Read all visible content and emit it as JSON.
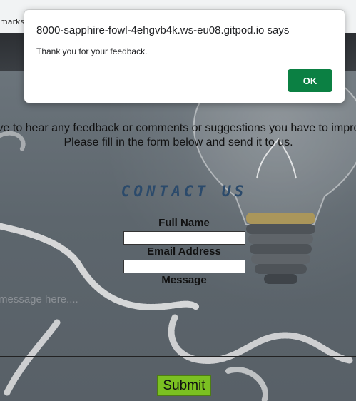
{
  "browser": {
    "bookmarks_fragment": "marks"
  },
  "page": {
    "intro_line1": "ove to hear any feedback or comments or suggestions you have to improv",
    "intro_line2": "Please fill in the form below and send it to us.",
    "contact_heading": "CONTACT US",
    "form": {
      "full_name_label": "Full Name",
      "full_name_value": "",
      "email_label": "Email Address",
      "email_value": "",
      "message_label": "Message",
      "message_placeholder": "message here....",
      "submit_label": "Submit"
    }
  },
  "dialog": {
    "title": "8000-sapphire-fowl-4ehgvb4k.ws-eu08.gitpod.io says",
    "message": "Thank you for your feedback.",
    "ok_label": "OK"
  },
  "colors": {
    "ok_button": "#0b8043",
    "submit_button": "#7bc022",
    "heading": "#2b4a6b"
  }
}
